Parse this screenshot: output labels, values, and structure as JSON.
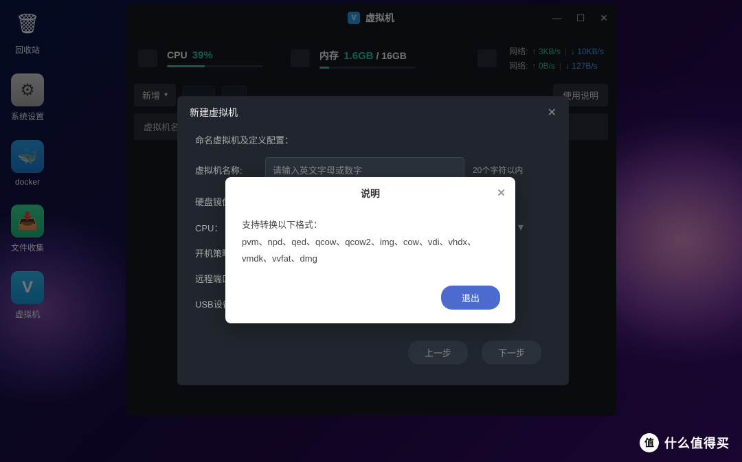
{
  "desktop": [
    {
      "label": "回收站",
      "icon": "🗑"
    },
    {
      "label": "系统设置",
      "icon": "⚙"
    },
    {
      "label": "docker",
      "icon": "🐳"
    },
    {
      "label": "文件收集",
      "icon": "📥"
    },
    {
      "label": "虚拟机",
      "icon": "V"
    }
  ],
  "window": {
    "title": "虚拟机",
    "cpu_label": "CPU",
    "cpu_value": "39%",
    "cpu_pct": 39,
    "mem_label": "内存",
    "mem_used": "1.6GB",
    "mem_total": "16GB",
    "mem_pct": 10,
    "net1_label": "网络:",
    "net1_up": "↑ 3KB/s",
    "net1_dn": "↓ 10KB/s",
    "net2_label": "网络:",
    "net2_up": "↑ 0B/s",
    "net2_dn": "↓ 127B/s",
    "new_btn": "新增",
    "help_btn": "使用说明",
    "col_name": "虚拟机名称"
  },
  "dialog1": {
    "title": "新建虚拟机",
    "subtitle": "命名虚拟机及定义配置：",
    "name_label": "虚拟机名称:",
    "name_placeholder": "请输入英文字母或数字",
    "name_hint": "20个字符以内",
    "disk_label": "硬盘镜像",
    "cpu_label": "CPU：",
    "boot_label": "开机策略",
    "port_label": "远程端口",
    "usb_label": "USB设备",
    "prev": "上一步",
    "next": "下一步"
  },
  "dialog2": {
    "title": "说明",
    "line1": "支持转换以下格式：",
    "line2": "pvm、npd、qed、qcow、qcow2、img、cow、vdi、vhdx、vmdk、vvfat、dmg",
    "exit": "退出"
  },
  "watermark": {
    "badge": "值",
    "text": "什么值得买"
  }
}
